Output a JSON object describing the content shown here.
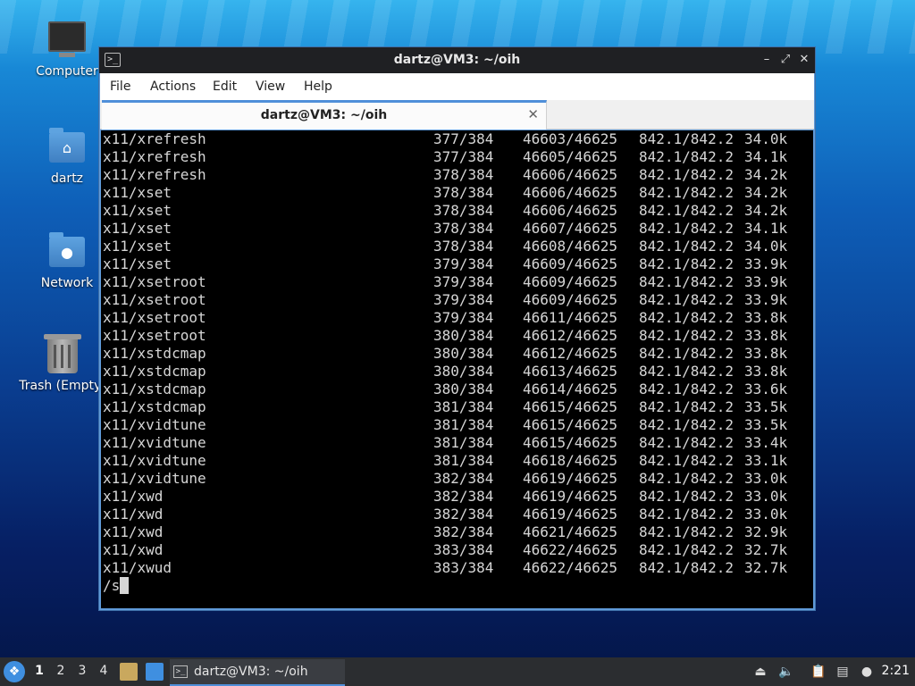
{
  "desktop": {
    "icons": [
      {
        "label": "Computer",
        "icon": "computer-icon"
      },
      {
        "label": "dartz",
        "icon": "home-folder-icon"
      },
      {
        "label": "Network",
        "icon": "network-folder-icon"
      },
      {
        "label": "Trash (Empty)",
        "icon": "trash-icon"
      }
    ]
  },
  "window": {
    "title": "dartz@VM3: ~/oih",
    "menu": [
      "File",
      "Actions",
      "Edit",
      "View",
      "Help"
    ],
    "tab_title": "dartz@VM3: ~/oih",
    "controls": {
      "minimize": "–",
      "maximize": "⤢",
      "close": "✕"
    }
  },
  "terminal": {
    "rows": [
      {
        "name": "x11/xrefresh",
        "pkg": "377/384",
        "files": "46603/46625",
        "size": "842.1/842.2",
        "rate": "34.0k"
      },
      {
        "name": "x11/xrefresh",
        "pkg": "377/384",
        "files": "46605/46625",
        "size": "842.1/842.2",
        "rate": "34.1k"
      },
      {
        "name": "x11/xrefresh",
        "pkg": "378/384",
        "files": "46606/46625",
        "size": "842.1/842.2",
        "rate": "34.2k"
      },
      {
        "name": "x11/xset",
        "pkg": "378/384",
        "files": "46606/46625",
        "size": "842.1/842.2",
        "rate": "34.2k"
      },
      {
        "name": "x11/xset",
        "pkg": "378/384",
        "files": "46606/46625",
        "size": "842.1/842.2",
        "rate": "34.2k"
      },
      {
        "name": "x11/xset",
        "pkg": "378/384",
        "files": "46607/46625",
        "size": "842.1/842.2",
        "rate": "34.1k"
      },
      {
        "name": "x11/xset",
        "pkg": "378/384",
        "files": "46608/46625",
        "size": "842.1/842.2",
        "rate": "34.0k"
      },
      {
        "name": "x11/xset",
        "pkg": "379/384",
        "files": "46609/46625",
        "size": "842.1/842.2",
        "rate": "33.9k"
      },
      {
        "name": "x11/xsetroot",
        "pkg": "379/384",
        "files": "46609/46625",
        "size": "842.1/842.2",
        "rate": "33.9k"
      },
      {
        "name": "x11/xsetroot",
        "pkg": "379/384",
        "files": "46609/46625",
        "size": "842.1/842.2",
        "rate": "33.9k"
      },
      {
        "name": "x11/xsetroot",
        "pkg": "379/384",
        "files": "46611/46625",
        "size": "842.1/842.2",
        "rate": "33.8k"
      },
      {
        "name": "x11/xsetroot",
        "pkg": "380/384",
        "files": "46612/46625",
        "size": "842.1/842.2",
        "rate": "33.8k"
      },
      {
        "name": "x11/xstdcmap",
        "pkg": "380/384",
        "files": "46612/46625",
        "size": "842.1/842.2",
        "rate": "33.8k"
      },
      {
        "name": "x11/xstdcmap",
        "pkg": "380/384",
        "files": "46613/46625",
        "size": "842.1/842.2",
        "rate": "33.8k"
      },
      {
        "name": "x11/xstdcmap",
        "pkg": "380/384",
        "files": "46614/46625",
        "size": "842.1/842.2",
        "rate": "33.6k"
      },
      {
        "name": "x11/xstdcmap",
        "pkg": "381/384",
        "files": "46615/46625",
        "size": "842.1/842.2",
        "rate": "33.5k"
      },
      {
        "name": "x11/xvidtune",
        "pkg": "381/384",
        "files": "46615/46625",
        "size": "842.1/842.2",
        "rate": "33.5k"
      },
      {
        "name": "x11/xvidtune",
        "pkg": "381/384",
        "files": "46615/46625",
        "size": "842.1/842.2",
        "rate": "33.4k"
      },
      {
        "name": "x11/xvidtune",
        "pkg": "381/384",
        "files": "46618/46625",
        "size": "842.1/842.2",
        "rate": "33.1k"
      },
      {
        "name": "x11/xvidtune",
        "pkg": "382/384",
        "files": "46619/46625",
        "size": "842.1/842.2",
        "rate": "33.0k"
      },
      {
        "name": "x11/xwd",
        "pkg": "382/384",
        "files": "46619/46625",
        "size": "842.1/842.2",
        "rate": "33.0k"
      },
      {
        "name": "x11/xwd",
        "pkg": "382/384",
        "files": "46619/46625",
        "size": "842.1/842.2",
        "rate": "33.0k"
      },
      {
        "name": "x11/xwd",
        "pkg": "382/384",
        "files": "46621/46625",
        "size": "842.1/842.2",
        "rate": "32.9k"
      },
      {
        "name": "x11/xwd",
        "pkg": "383/384",
        "files": "46622/46625",
        "size": "842.1/842.2",
        "rate": "32.7k"
      },
      {
        "name": "x11/xwud",
        "pkg": "383/384",
        "files": "46622/46625",
        "size": "842.1/842.2",
        "rate": "32.7k"
      }
    ],
    "prompt": "/s"
  },
  "taskbar": {
    "workspaces": [
      "1",
      "2",
      "3",
      "4"
    ],
    "active_workspace": "1",
    "task_label": "dartz@VM3: ~/oih",
    "clock": "2:21"
  }
}
